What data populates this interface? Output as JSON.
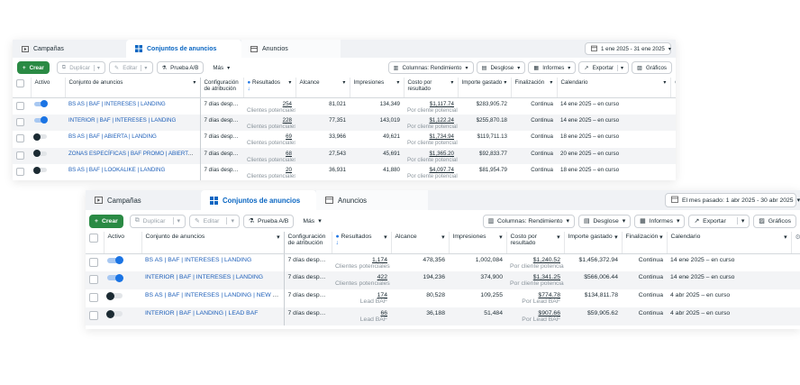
{
  "top": {
    "tabs": [
      {
        "label": "Campañas",
        "icon": "campaigns-icon"
      },
      {
        "label": "Conjuntos de anuncios",
        "icon": "adsets-icon"
      },
      {
        "label": "Anuncios",
        "icon": "ads-icon"
      }
    ],
    "date_range": "1 ene 2025 - 31 ene 2025",
    "toolbar": {
      "create": "Crear",
      "duplicate": "Duplicar",
      "edit": "Editar",
      "ab_test": "Prueba A/B",
      "more": "Más",
      "columns": "Columnas: Rendimiento",
      "breakdown": "Desglose",
      "reports": "Informes",
      "export": "Exportar",
      "charts": "Gráficos"
    },
    "headers": {
      "active": "Activo",
      "adset": "Conjunto de anuncios",
      "attribution": "Configuración de atribución",
      "results": "Resultados",
      "reach": "Alcance",
      "impressions": "Impresiones",
      "cost_per_result": "Costo por resultado",
      "amount_spent": "Importe gastado",
      "ends": "Finalización",
      "schedule": "Calendario"
    },
    "rows": [
      {
        "on": true,
        "name": "BS AS | BAF | INTERESES | LANDING",
        "attribution": "7 días después...",
        "results": "254",
        "results_sub": "Clientes potenciales e...",
        "reach": "81,021",
        "impressions": "134,349",
        "cpr": "$1,117.74",
        "cpr_sub": "Por cliente potencial",
        "spent": "$283,905.72",
        "ends": "Continua",
        "schedule": "14 ene 2025 – en curso"
      },
      {
        "on": true,
        "name": "INTERIOR | BAF | INTERESES | LANDING",
        "attribution": "7 días después...",
        "results": "228",
        "results_sub": "Clientes potenciales e...",
        "reach": "77,351",
        "impressions": "143,019",
        "cpr": "$1,122.24",
        "cpr_sub": "Por cliente potencial",
        "spent": "$255,870.18",
        "ends": "Continua",
        "schedule": "14 ene 2025 – en curso"
      },
      {
        "on": false,
        "name": "BS AS | BAF | ABIERTA | LANDING",
        "attribution": "7 días después...",
        "results": "69",
        "results_sub": "Clientes potenciales e...",
        "reach": "33,966",
        "impressions": "49,621",
        "cpr": "$1,734.94",
        "cpr_sub": "Por cliente potencial",
        "spent": "$119,711.13",
        "ends": "Continua",
        "schedule": "18 ene 2025 – en curso"
      },
      {
        "on": false,
        "name": "ZONAS ESPECÍFICAS | BAF PROMO | ABIERTA | LANDI...",
        "attribution": "7 días después...",
        "results": "68",
        "results_sub": "Clientes potenciales e...",
        "reach": "27,543",
        "impressions": "45,691",
        "cpr": "$1,365.20",
        "cpr_sub": "Por cliente potencial",
        "spent": "$92,833.77",
        "ends": "Continua",
        "schedule": "20 ene 2025 – en curso"
      },
      {
        "on": false,
        "name": "BS AS | BAF | LOOKALIKE | LANDING",
        "attribution": "7 días después...",
        "results": "20",
        "results_sub": "Clientes potenciales e...",
        "reach": "36,931",
        "impressions": "41,880",
        "cpr": "$4,097.74",
        "cpr_sub": "Por cliente potencial",
        "spent": "$81,954.79",
        "ends": "Continua",
        "schedule": "18 ene 2025 – en curso"
      }
    ]
  },
  "bottom": {
    "tabs": [
      {
        "label": "Campañas",
        "icon": "campaigns-icon"
      },
      {
        "label": "Conjuntos de anuncios",
        "icon": "adsets-icon"
      },
      {
        "label": "Anuncios",
        "icon": "ads-icon"
      }
    ],
    "date_range": "El mes pasado: 1 abr 2025 - 30 abr 2025",
    "toolbar": {
      "create": "Crear",
      "duplicate": "Duplicar",
      "edit": "Editar",
      "ab_test": "Prueba A/B",
      "more": "Más",
      "columns": "Columnas: Rendimiento",
      "breakdown": "Desglose",
      "reports": "Informes",
      "export": "Exportar",
      "charts": "Gráficos"
    },
    "headers": {
      "active": "Activo",
      "adset": "Conjunto de anuncios",
      "attribution": "Configuración de atribución",
      "results": "Resultados",
      "reach": "Alcance",
      "impressions": "Impresiones",
      "cost_per_result": "Costo por resultado",
      "amount_spent": "Importe gastado",
      "ends": "Finalización",
      "schedule": "Calendario"
    },
    "rows": [
      {
        "on": true,
        "name": "BS AS | BAF | INTERESES | LANDING",
        "attribution": "7 días después...",
        "results": "1,174",
        "results_sub": "Clientes potenciales e...",
        "reach": "478,356",
        "impressions": "1,002,084",
        "cpr": "$1,240.52",
        "cpr_sub": "Por cliente potencial",
        "spent": "$1,456,372.94",
        "ends": "Continua",
        "schedule": "14 ene 2025 – en curso"
      },
      {
        "on": true,
        "name": "INTERIOR | BAF | INTERESES | LANDING",
        "attribution": "7 días después...",
        "results": "422",
        "results_sub": "Clientes potenciales e...",
        "reach": "194,236",
        "impressions": "374,900",
        "cpr": "$1,341.25",
        "cpr_sub": "Por cliente potencial",
        "spent": "$566,006.44",
        "ends": "Continua",
        "schedule": "14 ene 2025 – en curso"
      },
      {
        "on": false,
        "name": "BS AS | BAF | INTERESES | LANDING | NEW LEAD EVENT",
        "attribution": "7 días después...",
        "results": "174",
        "results_sub": "Lead BAF",
        "reach": "80,528",
        "impressions": "109,255",
        "cpr": "$774.78",
        "cpr_sub": "Por Lead BAF",
        "spent": "$134,811.78",
        "ends": "Continua",
        "schedule": "4 abr 2025 – en curso"
      },
      {
        "on": false,
        "name": "INTERIOR | BAF | LANDING | LEAD BAF",
        "attribution": "7 días después...",
        "results": "66",
        "results_sub": "Lead BAF",
        "reach": "36,188",
        "impressions": "51,484",
        "cpr": "$907.66",
        "cpr_sub": "Por Lead BAF",
        "spent": "$59,905.62",
        "ends": "Continua",
        "schedule": "4 abr 2025 – en curso"
      }
    ]
  }
}
